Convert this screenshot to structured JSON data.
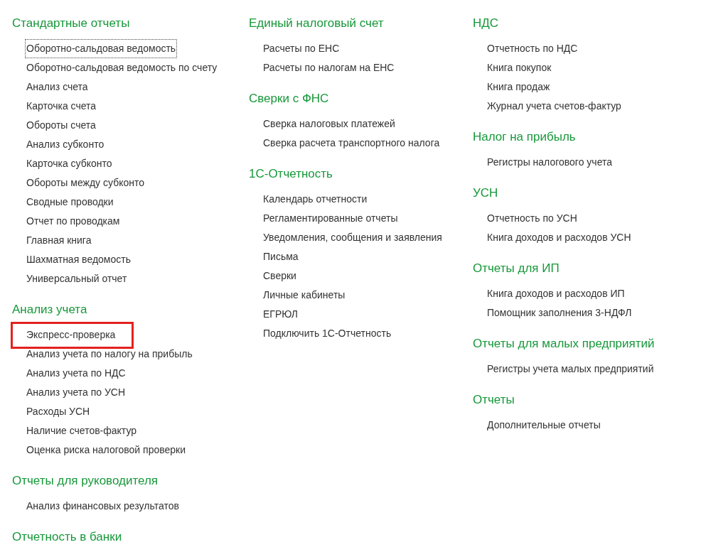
{
  "columns": [
    {
      "sections": [
        {
          "title": "Стандартные отчеты",
          "items": [
            {
              "label": "Оборотно-сальдовая ведомость",
              "focused": true,
              "highlighted": false
            },
            {
              "label": "Оборотно-сальдовая ведомость по счету",
              "focused": false,
              "highlighted": false
            },
            {
              "label": "Анализ счета",
              "focused": false,
              "highlighted": false
            },
            {
              "label": "Карточка счета",
              "focused": false,
              "highlighted": false
            },
            {
              "label": "Обороты счета",
              "focused": false,
              "highlighted": false
            },
            {
              "label": "Анализ субконто",
              "focused": false,
              "highlighted": false
            },
            {
              "label": "Карточка субконто",
              "focused": false,
              "highlighted": false
            },
            {
              "label": "Обороты между субконто",
              "focused": false,
              "highlighted": false
            },
            {
              "label": "Сводные проводки",
              "focused": false,
              "highlighted": false
            },
            {
              "label": "Отчет по проводкам",
              "focused": false,
              "highlighted": false
            },
            {
              "label": "Главная книга",
              "focused": false,
              "highlighted": false
            },
            {
              "label": "Шахматная ведомость",
              "focused": false,
              "highlighted": false
            },
            {
              "label": "Универсальный отчет",
              "focused": false,
              "highlighted": false
            }
          ]
        },
        {
          "title": "Анализ учета",
          "items": [
            {
              "label": "Экспресс-проверка",
              "focused": false,
              "highlighted": true
            },
            {
              "label": "Анализ учета по налогу на прибыль",
              "focused": false,
              "highlighted": false
            },
            {
              "label": "Анализ учета по НДС",
              "focused": false,
              "highlighted": false
            },
            {
              "label": "Анализ учета по УСН",
              "focused": false,
              "highlighted": false
            },
            {
              "label": "Расходы УСН",
              "focused": false,
              "highlighted": false
            },
            {
              "label": "Наличие счетов-фактур",
              "focused": false,
              "highlighted": false
            },
            {
              "label": "Оценка риска налоговой проверки",
              "focused": false,
              "highlighted": false
            }
          ]
        },
        {
          "title": "Отчеты для руководителя",
          "items": [
            {
              "label": "Анализ финансовых результатов",
              "focused": false,
              "highlighted": false
            }
          ]
        },
        {
          "title": "Отчетность в банки"
        }
      ]
    },
    {
      "sections": [
        {
          "title": "Единый налоговый счет",
          "items": [
            {
              "label": "Расчеты по ЕНС",
              "focused": false,
              "highlighted": false
            },
            {
              "label": "Расчеты по налогам на ЕНС",
              "focused": false,
              "highlighted": false
            }
          ]
        },
        {
          "title": "Сверки с ФНС",
          "items": [
            {
              "label": "Сверка налоговых платежей",
              "focused": false,
              "highlighted": false
            },
            {
              "label": "Сверка расчета транспортного налога",
              "focused": false,
              "highlighted": false
            }
          ]
        },
        {
          "title": "1С-Отчетность",
          "items": [
            {
              "label": "Календарь отчетности",
              "focused": false,
              "highlighted": false
            },
            {
              "label": "Регламентированные отчеты",
              "focused": false,
              "highlighted": false
            },
            {
              "label": "Уведомления, сообщения и заявления",
              "focused": false,
              "highlighted": false
            },
            {
              "label": "Письма",
              "focused": false,
              "highlighted": false
            },
            {
              "label": "Сверки",
              "focused": false,
              "highlighted": false
            },
            {
              "label": "Личные кабинеты",
              "focused": false,
              "highlighted": false
            },
            {
              "label": "ЕГРЮЛ",
              "focused": false,
              "highlighted": false
            },
            {
              "label": "Подключить 1С-Отчетность",
              "focused": false,
              "highlighted": false
            }
          ]
        }
      ]
    },
    {
      "sections": [
        {
          "title": "НДС",
          "items": [
            {
              "label": "Отчетность по НДС",
              "focused": false,
              "highlighted": false
            },
            {
              "label": "Книга покупок",
              "focused": false,
              "highlighted": false
            },
            {
              "label": "Книга продаж",
              "focused": false,
              "highlighted": false
            },
            {
              "label": "Журнал учета счетов-фактур",
              "focused": false,
              "highlighted": false
            }
          ]
        },
        {
          "title": "Налог на прибыль",
          "items": [
            {
              "label": "Регистры налогового учета",
              "focused": false,
              "highlighted": false
            }
          ]
        },
        {
          "title": "УСН",
          "items": [
            {
              "label": "Отчетность по УСН",
              "focused": false,
              "highlighted": false
            },
            {
              "label": "Книга доходов и расходов УСН",
              "focused": false,
              "highlighted": false
            }
          ]
        },
        {
          "title": "Отчеты для ИП",
          "items": [
            {
              "label": "Книга доходов и расходов ИП",
              "focused": false,
              "highlighted": false
            },
            {
              "label": "Помощник заполнения 3-НДФЛ",
              "focused": false,
              "highlighted": false
            }
          ]
        },
        {
          "title": "Отчеты для малых предприятий",
          "items": [
            {
              "label": "Регистры учета малых предприятий",
              "focused": false,
              "highlighted": false
            }
          ]
        },
        {
          "title": "Отчеты",
          "items": [
            {
              "label": "Дополнительные отчеты",
              "focused": false,
              "highlighted": false
            }
          ]
        }
      ]
    }
  ]
}
